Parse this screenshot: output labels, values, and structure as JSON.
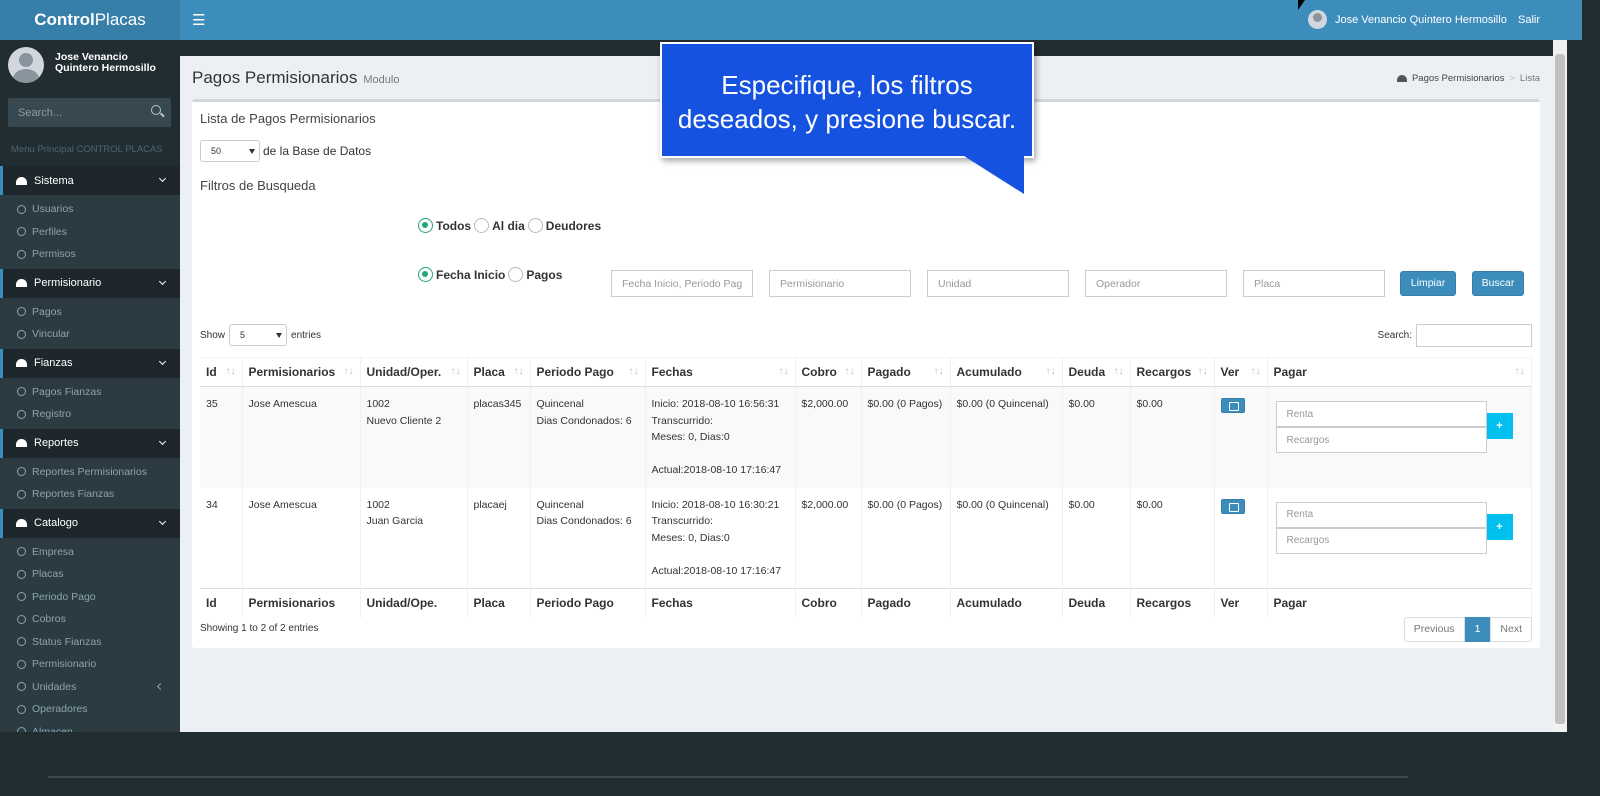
{
  "app": {
    "brand_bold": "Control",
    "brand_light": "Placas"
  },
  "topbar": {
    "user_name": "Jose Venancio Quintero Hermosillo",
    "logout": "Salir"
  },
  "sidebar": {
    "user_name": "Jose Venancio Quintero Hermosillo",
    "search_placeholder": "Search...",
    "menu_header": "Menu Principal CONTROL PLACAS",
    "sections": [
      {
        "label": "Sistema",
        "items": [
          "Usuarios",
          "Perfiles",
          "Permisos"
        ]
      },
      {
        "label": "Permisionario",
        "items": [
          "Pagos",
          "Vincular"
        ]
      },
      {
        "label": "Fianzas",
        "items": [
          "Pagos Fianzas",
          "Registro"
        ]
      },
      {
        "label": "Reportes",
        "items": [
          "Reportes Permisionarios",
          "Reportes Fianzas"
        ]
      },
      {
        "label": "Catalogo",
        "items": [
          "Empresa",
          "Placas",
          "Periodo Pago",
          "Cobros",
          "Status Fianzas",
          "Permisionario",
          "Unidades",
          "Operadores",
          "Almacen"
        ]
      }
    ]
  },
  "page": {
    "title": "Pagos Permisionarios",
    "subtitle": "Modulo",
    "breadcrumb": [
      "Pagos Permisionarios",
      "Lista"
    ]
  },
  "box": {
    "title": "Lista de Pagos Permisionarios",
    "records_value": "50",
    "records_suffix": "de la Base de Datos",
    "filters_title": "Filtros de Busqueda",
    "status_radios": [
      "Todos",
      "Al dia",
      "Deudores"
    ],
    "status_selected": "Todos",
    "date_radios": [
      "Fecha Inicio",
      "Pagos"
    ],
    "date_selected": "Fecha Inicio",
    "filter_placeholders": [
      "Fecha Inicio, Periodo Pago",
      "Permisionario",
      "Unidad",
      "Operador",
      "Placa"
    ],
    "btn_clear": "Limpiar",
    "btn_search": "Buscar"
  },
  "table": {
    "show_label": "Show",
    "show_value": "5",
    "entries_label": "entries",
    "search_label": "Search:",
    "columns": [
      "Id",
      "Permisionarios",
      "Unidad/Oper.",
      "Placa",
      "Periodo Pago",
      "Fechas",
      "Cobro",
      "Pagado",
      "Acumulado",
      "Deuda",
      "Recargos",
      "Ver",
      "Pagar"
    ],
    "footer_columns": [
      "Id",
      "Permisionarios",
      "Unidad/Ope.",
      "Placa",
      "Periodo Pago",
      "Fechas",
      "Cobro",
      "Pagado",
      "Acumulado",
      "Deuda",
      "Recargos",
      "Ver",
      "Pagar"
    ],
    "rows": [
      {
        "id": "35",
        "permisionario": "Jose Amescua",
        "unidad": "1002",
        "operador": "Nuevo Cliente 2",
        "placa": "placas345",
        "periodo": "Quincenal",
        "condonados": "Dias Condonados: 6",
        "inicio": "Inicio: 2018-08-10 16:56:31",
        "transcurrido": "Transcurrido:",
        "meses": "Meses: 0, Dias:0",
        "actual": "Actual:2018-08-10 17:16:47",
        "cobro": "$2,000.00",
        "pagado": "$0.00 (0 Pagos)",
        "acumulado": "$0.00 (0 Quincenal)",
        "deuda": "$0.00",
        "recargos": "$0.00"
      },
      {
        "id": "34",
        "permisionario": "Jose Amescua",
        "unidad": "1002",
        "operador": "Juan Garcia",
        "placa": "placaej",
        "periodo": "Quincenal",
        "condonados": "Dias Condonados: 6",
        "inicio": "Inicio: 2018-08-10 16:30:21",
        "transcurrido": "Transcurrido:",
        "meses": "Meses: 0, Dias:0",
        "actual": "Actual:2018-08-10 17:16:47",
        "cobro": "$2,000.00",
        "pagado": "$0.00 (0 Pagos)",
        "acumulado": "$0.00 (0 Quincenal)",
        "deuda": "$0.00",
        "recargos": "$0.00"
      }
    ],
    "pay_placeholders": [
      "Renta",
      "Recargos"
    ],
    "pay_button": "+",
    "info": "Showing 1 to 2 of 2 entries",
    "pager": [
      "Previous",
      "1",
      "Next"
    ]
  },
  "callout": {
    "text": "Especifique, los filtros deseados, y presione buscar."
  },
  "colors": {
    "primary": "#3c8dbc",
    "sidebar": "#222d32",
    "callout": "#1652e0",
    "radio": "#1fa67a",
    "add": "#00c0ef"
  }
}
